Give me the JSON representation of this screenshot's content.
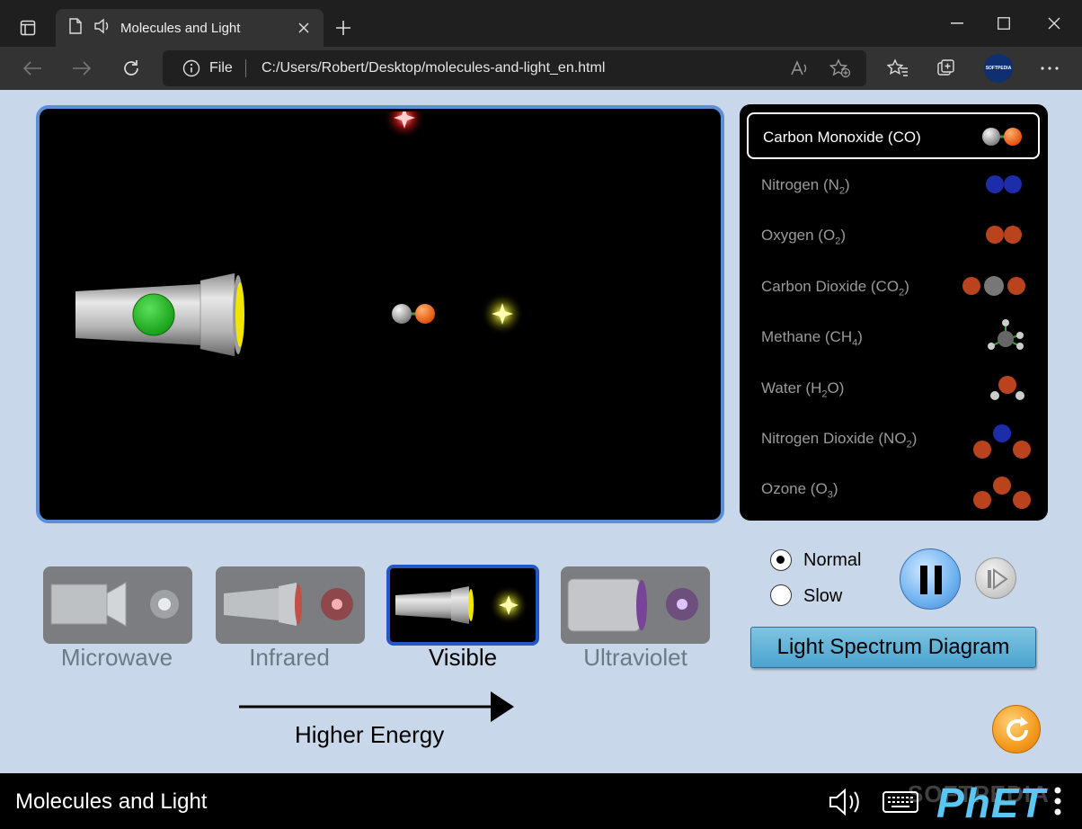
{
  "browser": {
    "tab_title": "Molecules and Light",
    "address": {
      "file_label": "File",
      "url": "C:/Users/Robert/Desktop/molecules-and-light_en.html"
    },
    "profile_label": "SOFTPEDIA"
  },
  "molecules": [
    {
      "label": "Carbon Monoxide (CO)",
      "name": "Carbon Monoxide (CO)",
      "selected": true
    },
    {
      "label": "Nitrogen (N",
      "sub": "2",
      "suffix": ")",
      "selected": false
    },
    {
      "label": "Oxygen (O",
      "sub": "2",
      "suffix": ")",
      "selected": false
    },
    {
      "label": "Carbon Dioxide (CO",
      "sub": "2",
      "suffix": ")",
      "selected": false
    },
    {
      "label": "Methane (CH",
      "sub": "4",
      "suffix": ")",
      "selected": false
    },
    {
      "label": "Water (H",
      "sub": "2",
      "suffix": "O)",
      "selected": false
    },
    {
      "label": "Nitrogen Dioxide (NO",
      "sub": "2",
      "suffix": ")",
      "selected": false
    },
    {
      "label": "Ozone (O",
      "sub": "3",
      "suffix": ")",
      "selected": false
    }
  ],
  "light_sources": [
    {
      "label": "Microwave",
      "selected": false
    },
    {
      "label": "Infrared",
      "selected": false
    },
    {
      "label": "Visible",
      "selected": true
    },
    {
      "label": "Ultraviolet",
      "selected": false
    }
  ],
  "energy_label": "Higher Energy",
  "speed": {
    "normal_label": "Normal",
    "slow_label": "Slow",
    "selected": "Normal"
  },
  "spectrum_button_label": "Light Spectrum Diagram",
  "nav": {
    "title": "Molecules and Light",
    "logo": "PhET",
    "watermark": "SOFTPEDIA"
  },
  "colors": {
    "sim_background": "#c8d8ea",
    "play_border": "#5c8ed8",
    "selected_source_border": "#2456c8",
    "spectrum_button": "#4aa3cf",
    "reset_button": "#f39a1d"
  }
}
